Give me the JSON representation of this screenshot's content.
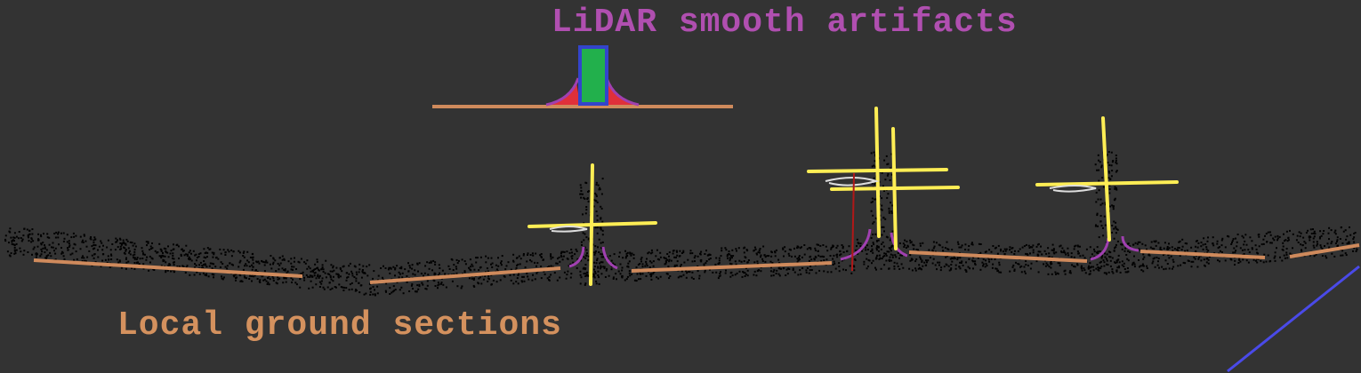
{
  "labels": {
    "artifacts": "LiDAR smooth artifacts",
    "ground": "Local ground sections"
  },
  "colors": {
    "background": "#333333",
    "title": "#b04fb0",
    "ground_label": "#d4915e",
    "ground_line": "#cf8a5c",
    "points": "#000000",
    "pole": "#ffee55",
    "artifact": "#a040b0",
    "inset_object_fill": "#22b04c",
    "inset_object_border": "#3344cc",
    "inset_artifact": "#e0303a",
    "axis_line": "#4a4ae8"
  }
}
